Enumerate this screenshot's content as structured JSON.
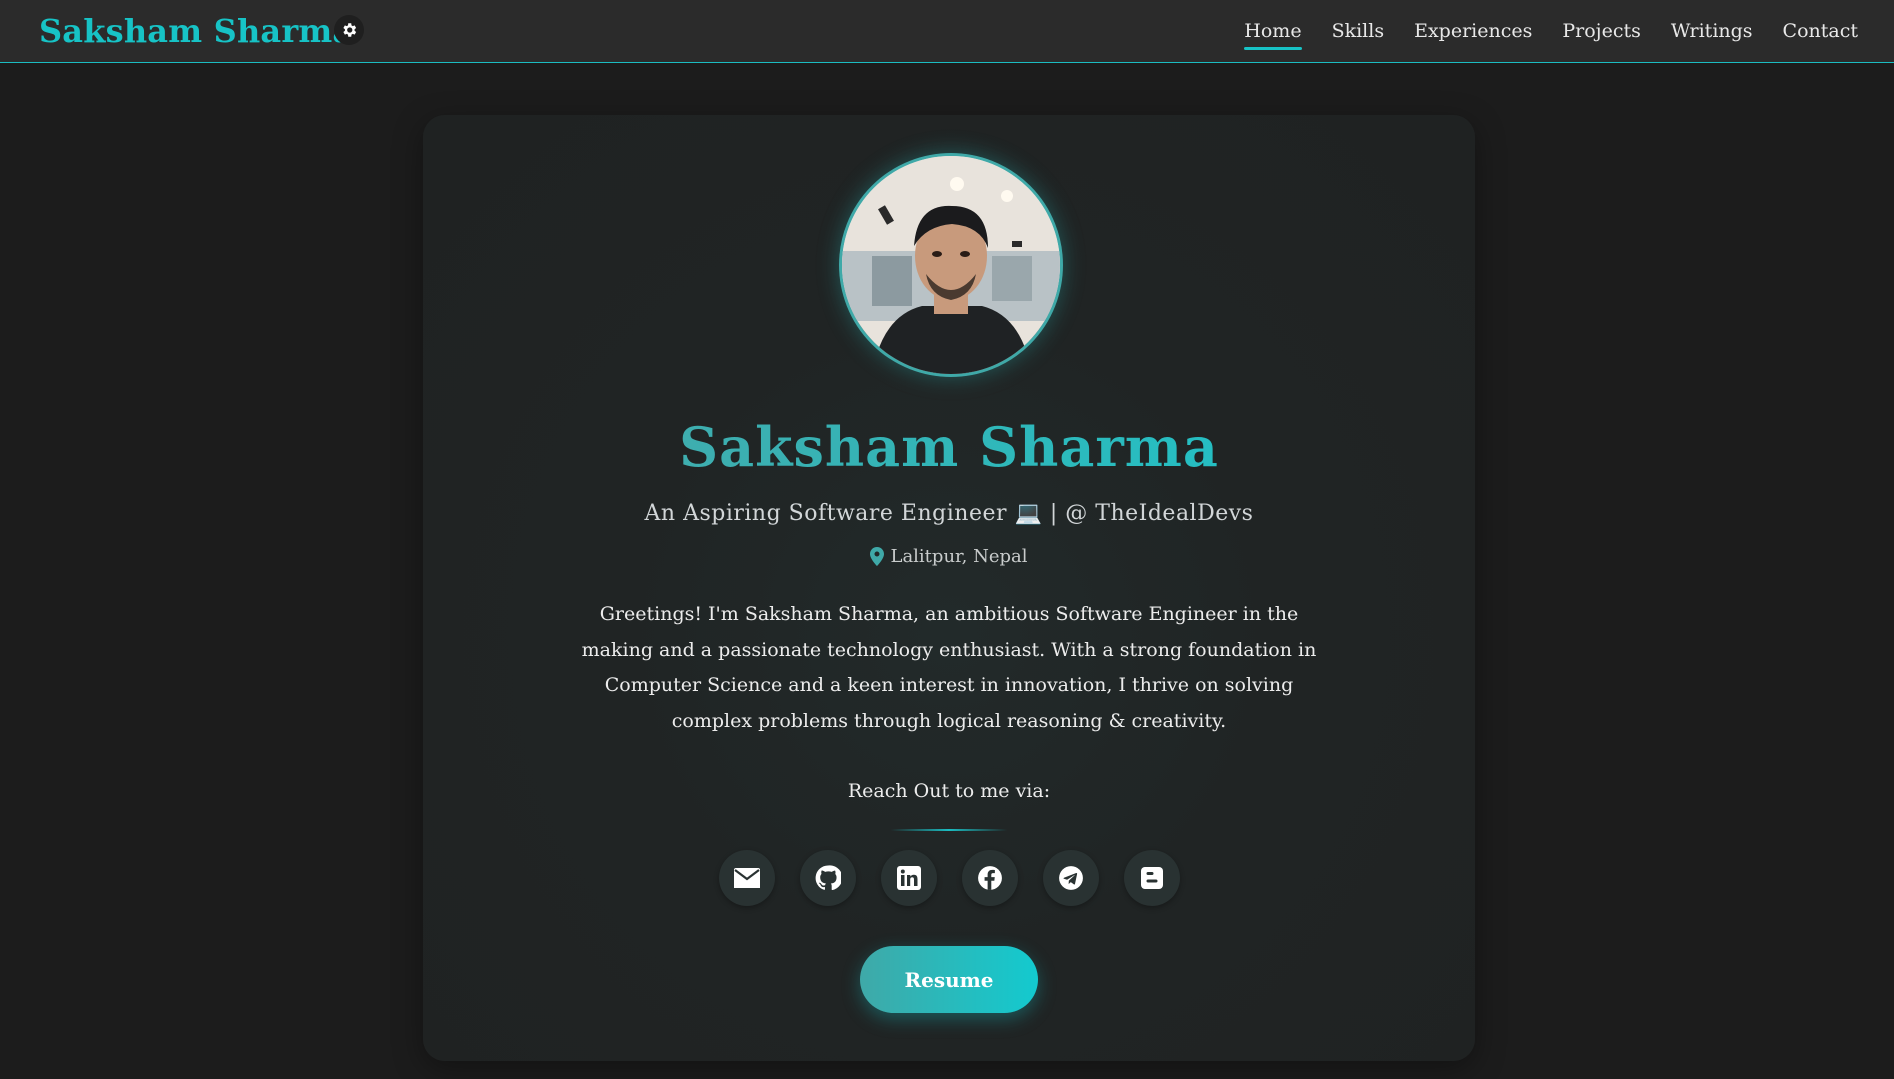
{
  "header": {
    "brand": "Saksham Sharma",
    "theme_toggle_icon": "gear-icon",
    "nav": [
      {
        "label": "Home",
        "active": true
      },
      {
        "label": "Skills",
        "active": false
      },
      {
        "label": "Experiences",
        "active": false
      },
      {
        "label": "Projects",
        "active": false
      },
      {
        "label": "Writings",
        "active": false
      },
      {
        "label": "Contact",
        "active": false
      }
    ]
  },
  "profile": {
    "avatar_alt": "profile-photo",
    "name": "Saksham Sharma",
    "tagline": "An Aspiring Software Engineer 💻 | @ TheIdealDevs",
    "location": "Lalitpur, Nepal",
    "bio": "Greetings! I'm Saksham Sharma, an ambitious Software Engineer in the making and a passionate technology enthusiast. With a strong foundation in Computer Science and a keen interest in innovation, I thrive on solving complex problems through logical reasoning & creativity."
  },
  "contact": {
    "heading": "Reach Out to me via:",
    "socials": [
      {
        "name": "email",
        "icon": "envelope-icon"
      },
      {
        "name": "github",
        "icon": "github-icon"
      },
      {
        "name": "linkedin",
        "icon": "linkedin-icon"
      },
      {
        "name": "facebook",
        "icon": "facebook-icon"
      },
      {
        "name": "telegram",
        "icon": "telegram-icon"
      },
      {
        "name": "blogger",
        "icon": "blogger-icon"
      }
    ],
    "resume_label": "Resume"
  },
  "colors": {
    "accent": "#17c3c6",
    "background": "#1c1c1c",
    "navbar": "#2b2b2b",
    "card": "#202424"
  }
}
